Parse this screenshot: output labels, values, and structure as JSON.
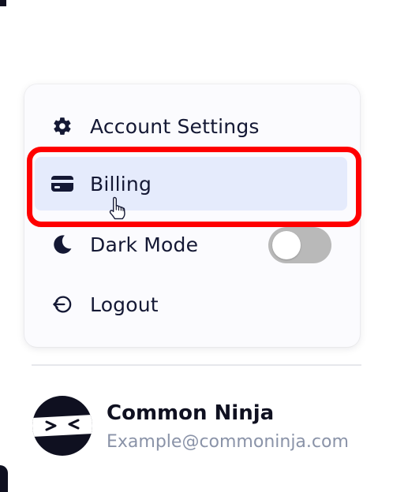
{
  "menu": {
    "items": [
      {
        "label": "Account Settings",
        "icon": "gear-icon"
      },
      {
        "label": "Billing",
        "icon": "credit-card-icon"
      },
      {
        "label": "Dark Mode",
        "icon": "moon-icon"
      },
      {
        "label": "Logout",
        "icon": "logout-icon"
      }
    ],
    "dark_mode_enabled": false
  },
  "user": {
    "name": "Common Ninja",
    "email": "Example@commoninja.com"
  },
  "colors": {
    "text": "#141834",
    "highlight_bg": "#e5ebfc",
    "annotation_ring": "#ff0000",
    "toggle_off": "#b9b9b9",
    "email": "#8a93a8"
  }
}
